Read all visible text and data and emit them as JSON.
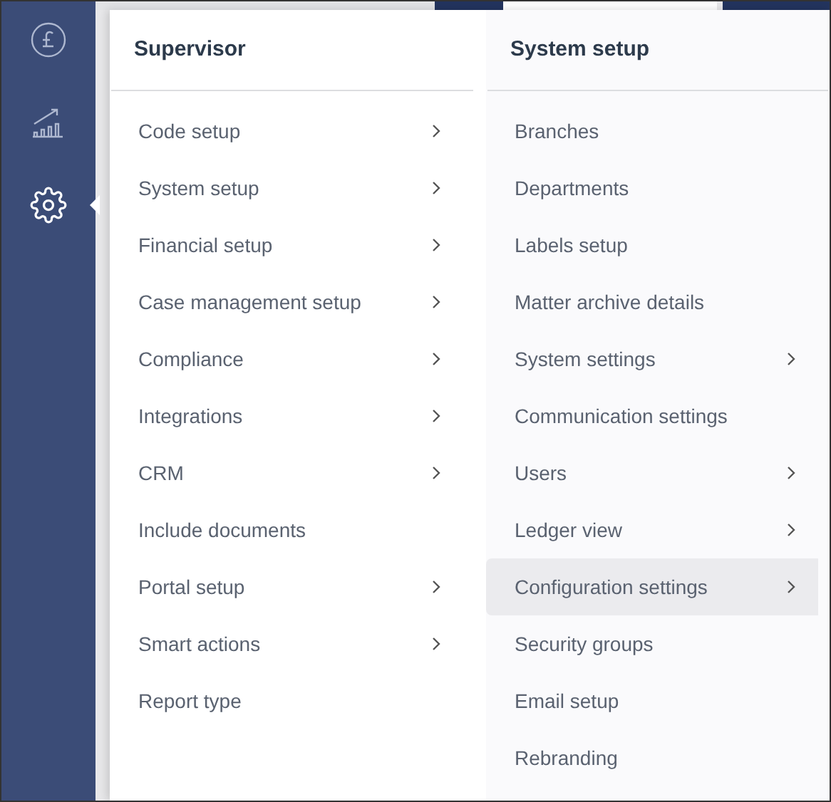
{
  "sidebar": {
    "items": [
      {
        "kind": "pound",
        "selected": false
      },
      {
        "kind": "chart",
        "selected": false
      },
      {
        "kind": "gear",
        "selected": true
      }
    ]
  },
  "menus": [
    {
      "title": "Supervisor",
      "items": [
        {
          "label": "Code setup",
          "has_submenu": true,
          "selected": false
        },
        {
          "label": "System setup",
          "has_submenu": true,
          "selected": false
        },
        {
          "label": "Financial setup",
          "has_submenu": true,
          "selected": false
        },
        {
          "label": "Case management setup",
          "has_submenu": true,
          "selected": false
        },
        {
          "label": "Compliance",
          "has_submenu": true,
          "selected": false
        },
        {
          "label": "Integrations",
          "has_submenu": true,
          "selected": false
        },
        {
          "label": "CRM",
          "has_submenu": true,
          "selected": false
        },
        {
          "label": "Include documents",
          "has_submenu": false,
          "selected": false
        },
        {
          "label": "Portal setup",
          "has_submenu": true,
          "selected": false
        },
        {
          "label": "Smart actions",
          "has_submenu": true,
          "selected": false
        },
        {
          "label": "Report type",
          "has_submenu": false,
          "selected": false
        }
      ]
    },
    {
      "title": "System setup",
      "items": [
        {
          "label": "Branches",
          "has_submenu": false,
          "selected": false
        },
        {
          "label": "Departments",
          "has_submenu": false,
          "selected": false
        },
        {
          "label": "Labels setup",
          "has_submenu": false,
          "selected": false
        },
        {
          "label": "Matter archive details",
          "has_submenu": false,
          "selected": false
        },
        {
          "label": "System settings",
          "has_submenu": true,
          "selected": false
        },
        {
          "label": "Communication settings",
          "has_submenu": false,
          "selected": false
        },
        {
          "label": "Users",
          "has_submenu": true,
          "selected": false
        },
        {
          "label": "Ledger view",
          "has_submenu": true,
          "selected": false
        },
        {
          "label": "Configuration settings",
          "has_submenu": true,
          "selected": true
        },
        {
          "label": "Security groups",
          "has_submenu": false,
          "selected": false
        },
        {
          "label": "Email setup",
          "has_submenu": false,
          "selected": false
        },
        {
          "label": "Rebranding",
          "has_submenu": false,
          "selected": false
        }
      ]
    }
  ]
}
